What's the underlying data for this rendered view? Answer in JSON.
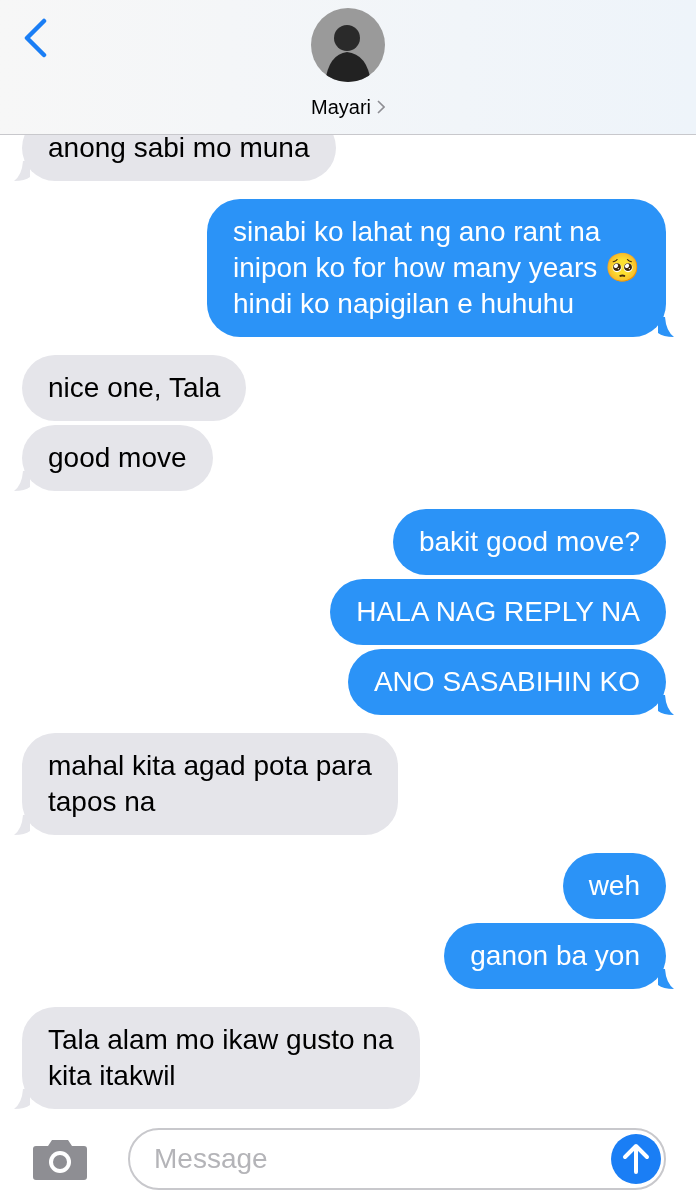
{
  "header": {
    "contact_name": "Mayari"
  },
  "messages": [
    {
      "kind": "received",
      "text": "anong sabi mo muna"
    },
    {
      "kind": "sent",
      "text": "sinabi ko lahat ng ano rant na\ninipon ko for how many years 🥺\nhindi ko napigilan e huhuhu"
    },
    {
      "kind": "received",
      "text": "nice one, Tala"
    },
    {
      "kind": "received",
      "text": "good move"
    },
    {
      "kind": "sent",
      "text": "bakit good move?"
    },
    {
      "kind": "sent",
      "text": "HALA NAG REPLY NA"
    },
    {
      "kind": "sent",
      "text": "ANO SASABIHIN KO"
    },
    {
      "kind": "received",
      "text": "mahal kita agad pota para\ntapos na"
    },
    {
      "kind": "sent",
      "text": "weh"
    },
    {
      "kind": "sent",
      "text": "ganon ba yon"
    },
    {
      "kind": "received",
      "text": "Tala alam mo ikaw gusto na\nkita itakwil"
    }
  ],
  "composer": {
    "placeholder": "Message"
  }
}
